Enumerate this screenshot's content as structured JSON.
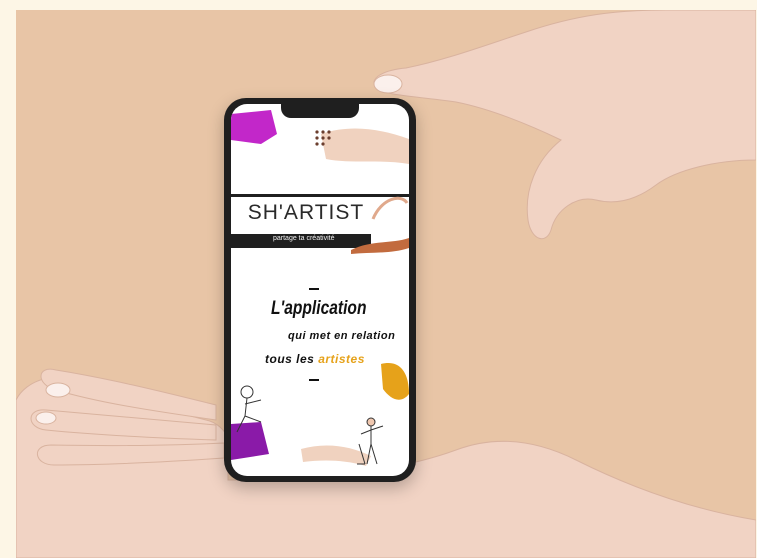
{
  "app": {
    "logo": "SH'ARTIST",
    "tagline": "partage ta créativité",
    "headline": "L'application",
    "subline": "qui met en relation",
    "last_line_prefix": "tous les",
    "last_line_accent": "artistes"
  },
  "colors": {
    "background": "#e8c5a6",
    "accent": "#e6a21a",
    "magenta": "#c227c9",
    "skin": "#f0d2bf"
  },
  "icons": [
    "hand-top",
    "hand-bottom",
    "smartphone",
    "artist-sketch",
    "violinist-sketch"
  ]
}
